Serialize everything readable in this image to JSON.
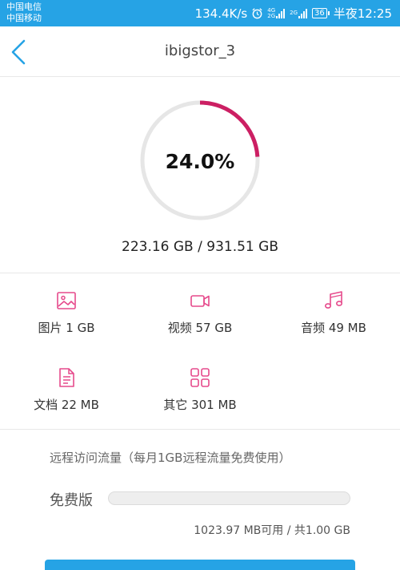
{
  "status_bar": {
    "carrier_1": "中国电信",
    "carrier_2": "中国移动",
    "net_speed": "134.4K/s",
    "net_tag_top": "4G",
    "net_tag_bottom": "2G",
    "net_tag_2": "2G",
    "battery": "36",
    "time": "半夜12:25"
  },
  "header": {
    "title": "ibigstor_3"
  },
  "storage": {
    "percent_text": "24.0%",
    "percent_value": 24.0,
    "usage_text": "223.16 GB / 931.51 GB"
  },
  "categories": [
    {
      "icon": "image-icon",
      "label": "图片 1 GB"
    },
    {
      "icon": "video-icon",
      "label": "视频 57 GB"
    },
    {
      "icon": "music-icon",
      "label": "音频 49 MB"
    },
    {
      "icon": "document-icon",
      "label": "文档 22 MB"
    },
    {
      "icon": "grid-icon",
      "label": "其它 301 MB"
    }
  ],
  "remote": {
    "title": "远程访问流量（每月1GB远程流量免费使用）",
    "plan": "免费版",
    "used_fraction": 0.0,
    "remain_text": "1023.97 MB可用 / 共1.00 GB"
  },
  "colors": {
    "accent": "#26a3e5",
    "ring_fill": "#cc1f63",
    "ring_track": "#e6e6e6",
    "category_icon": "#e64a8c"
  }
}
